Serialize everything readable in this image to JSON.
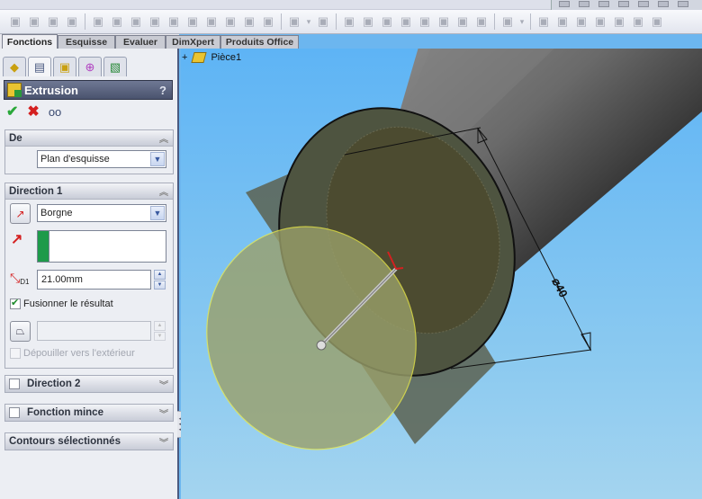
{
  "toolbar": {
    "icons": [
      "extruded-boss-icon",
      "revolved-boss-icon",
      "swept-boss-icon",
      "lofted-boss-icon",
      "extruded-cut-icon",
      "hole-wizard-icon",
      "revolved-cut-icon",
      "swept-cut-icon",
      "lofted-cut-icon",
      "fillet-icon",
      "chamfer-icon",
      "rib-icon",
      "draft-icon",
      "shell-icon",
      "linear-pattern-icon",
      "dropdown-icon",
      "wrap-icon",
      "dome-icon",
      "shape-icon",
      "split-line-icon",
      "flex-icon",
      "indent-icon",
      "deform-icon",
      "move-face-icon",
      "freeform-icon",
      "curves-icon",
      "dropdown-icon",
      "reference-geometry-icon",
      "sketch-driven-icon",
      "table-driven-icon",
      "fill-pattern-icon",
      "circular-pattern-icon",
      "mirror-icon",
      "combine-icon"
    ]
  },
  "tabs": [
    {
      "label": "Fonctions",
      "active": true
    },
    {
      "label": "Esquisse",
      "active": false
    },
    {
      "label": "Evaluer",
      "active": false
    },
    {
      "label": "DimXpert",
      "active": false
    },
    {
      "label": "Produits Office",
      "active": false
    }
  ],
  "panel": {
    "title": "Extrusion",
    "help": "?",
    "actions": {
      "ok": "✔",
      "cancel": "✖",
      "preview": "👓"
    },
    "from_group": {
      "title": "De",
      "selected": "Plan d'esquisse"
    },
    "direction1_group": {
      "title": "Direction 1",
      "end_condition": "Borgne",
      "depth": "21.00mm",
      "depth_label": "D1",
      "merge_result_label": "Fusionner le résultat",
      "merge_result_checked": true,
      "draft_outward_label": "Dépouiller vers l'extérieur",
      "draft_outward_checked": false,
      "draft_value": ""
    },
    "direction2_group": {
      "title": "Direction 2",
      "checked": false
    },
    "thin_feature_group": {
      "title": "Fonction mince",
      "checked": false
    },
    "selected_contours_group": {
      "title": "Contours sélectionnés"
    }
  },
  "feature_tree": {
    "expand": "+",
    "part_name": "Pièce1"
  },
  "viewport": {
    "dimension_label": "⌀40",
    "colors": {
      "background_top": "#5eb4f5",
      "preview_face": "#8f9660",
      "preview_edge": "#e8e84a",
      "cylinder_dark": "#1a1a1a"
    }
  }
}
